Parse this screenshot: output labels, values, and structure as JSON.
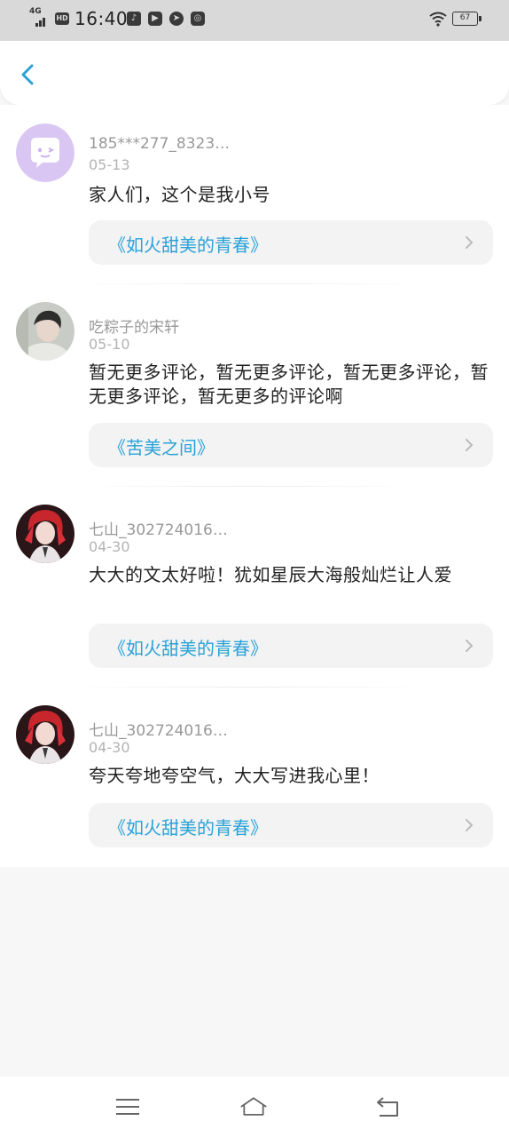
{
  "status_bar": {
    "network": "4G",
    "hd": "HD",
    "time": "16:40",
    "battery": "67"
  },
  "header": {
    "back_icon": "chevron-left-icon"
  },
  "comments": [
    {
      "username": "185***277_8323…",
      "date": "05-13",
      "text": "家人们，这个是我小号",
      "book": "《如火甜美的青春》"
    },
    {
      "username": "吃粽子的宋轩",
      "date": "05-10",
      "text": "暂无更多评论，暂无更多评论，暂无更多评论，暂无更多评论，暂无更多的评论啊",
      "book": "《苦美之间》"
    },
    {
      "username": "七山_302724016…",
      "date": "04-30",
      "text": "大大的文太好啦！犹如星辰大海般灿烂让人爱",
      "book": "《如火甜美的青春》"
    },
    {
      "username": "七山_302724016…",
      "date": "04-30",
      "text": "夸天夸地夸空气，大大写进我心里！",
      "book": "《如火甜美的青春》"
    }
  ],
  "colors": {
    "accent": "#2aa2d8",
    "username": "#999999",
    "avatar_default": "#d9c6f2"
  },
  "navbar": {
    "icons": [
      "menu-icon",
      "home-icon",
      "back-icon"
    ]
  }
}
